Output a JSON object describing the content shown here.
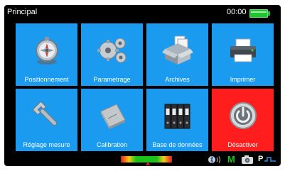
{
  "titlebar": {
    "title": "Principal",
    "time": "00:00"
  },
  "tiles": [
    {
      "label": "Positionnement",
      "icon": "compass-icon"
    },
    {
      "label": "Parametrage",
      "icon": "gears-icon"
    },
    {
      "label": "Archives",
      "icon": "archive-box-icon"
    },
    {
      "label": "Imprimer",
      "icon": "printer-icon"
    },
    {
      "label": "Réglage mesure",
      "icon": "wrench-icon"
    },
    {
      "label": "Calibration",
      "icon": "calibration-plate-icon"
    },
    {
      "label": "Base de données",
      "icon": "binders-icon"
    },
    {
      "label": "Désactiver",
      "icon": "power-icon"
    }
  ],
  "statusbar": {
    "mode_m": "M",
    "mode_p": "P"
  },
  "colors": {
    "tile": "#1a9bf0",
    "tile_power": "#ff1d1d",
    "battery": "#22c433",
    "mode_m": "#21c321"
  }
}
